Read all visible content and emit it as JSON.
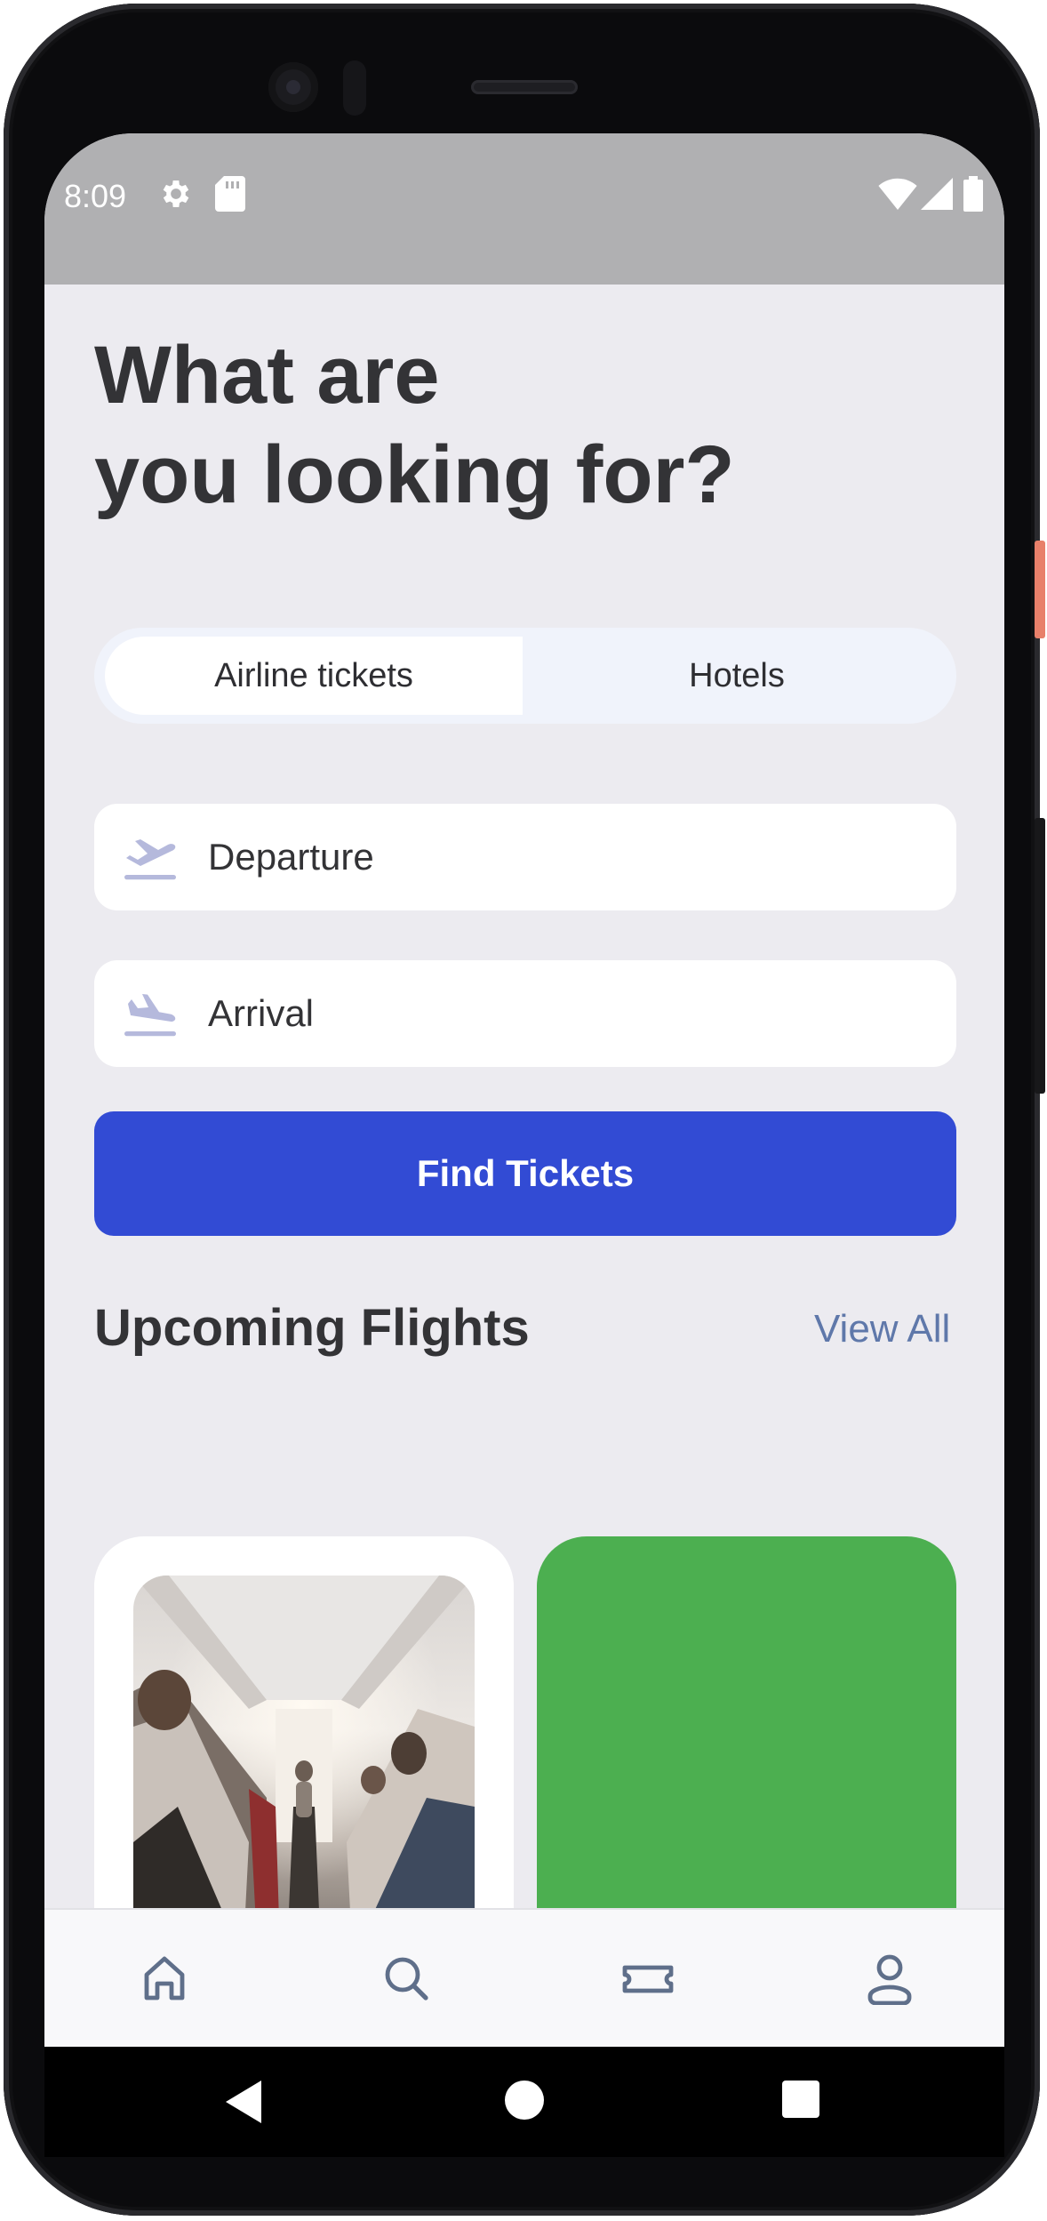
{
  "status_bar": {
    "time": "8:09",
    "left_icons": [
      "settings-icon",
      "sd-card-icon"
    ],
    "right_icons": [
      "wifi-icon",
      "cell-signal-icon",
      "battery-icon"
    ]
  },
  "headline": "What are\nyou looking for?",
  "search_tabs": [
    {
      "label": "Airline tickets",
      "selected": true
    },
    {
      "label": "Hotels",
      "selected": false
    }
  ],
  "fields": {
    "departure": {
      "label": "Departure",
      "icon": "plane-takeoff-icon"
    },
    "arrival": {
      "label": "Arrival",
      "icon": "plane-landing-icon"
    }
  },
  "find_button": "Find Tickets",
  "upcoming": {
    "title": "Upcoming Flights",
    "view_all": "View All"
  },
  "bottom_nav": [
    {
      "icon": "home-icon"
    },
    {
      "icon": "search-icon"
    },
    {
      "icon": "ticket-icon"
    },
    {
      "icon": "profile-icon"
    }
  ],
  "system_nav": [
    "back-icon",
    "home-circle-icon",
    "recents-icon"
  ],
  "colors": {
    "primary": "#324bd4",
    "accent_link": "#5f78aa",
    "background": "#ecebf0",
    "card_green": "#4caf50",
    "status_bar": "#b0b0b2"
  }
}
